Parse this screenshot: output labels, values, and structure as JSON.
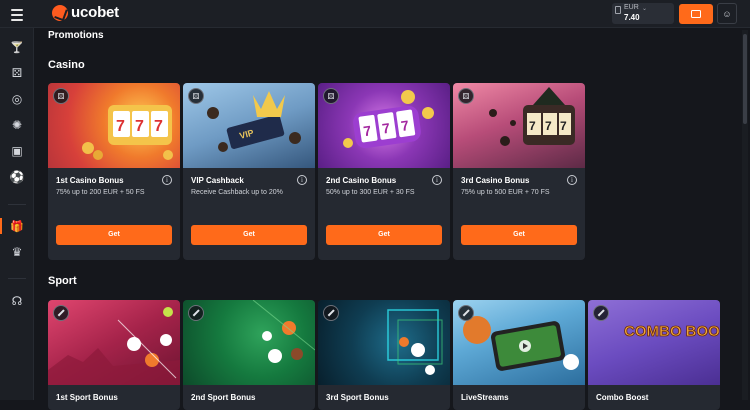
{
  "brand": {
    "name": "ucobet",
    "accent": "#ff6a1a"
  },
  "header": {
    "currency": "EUR",
    "balance": "7.40",
    "deposit_icon": "wallet-icon",
    "profile_icon": "user-icon"
  },
  "sidebar": {
    "items": [
      {
        "icon": "cocktail-icon",
        "glyph": "🍸"
      },
      {
        "icon": "dice-icon",
        "glyph": "⚄"
      },
      {
        "icon": "sport-ball-icon",
        "glyph": "◎"
      },
      {
        "icon": "roulette-icon",
        "glyph": "✺"
      },
      {
        "icon": "live-icon",
        "glyph": "▣"
      },
      {
        "icon": "football-icon",
        "glyph": "⚽"
      },
      {
        "icon": "gift-icon",
        "glyph": "🎁"
      },
      {
        "icon": "crown-icon",
        "glyph": "♛"
      },
      {
        "icon": "support-icon",
        "glyph": "☊"
      }
    ]
  },
  "main": {
    "title": "Promotions",
    "casino": {
      "title": "Casino",
      "cards": [
        {
          "title": "1st Casino Bonus",
          "desc": "75% up to 200 EUR + 50 FS",
          "button": "Get"
        },
        {
          "title": "VIP Cashback",
          "desc": "Receive Cashback up to 20%",
          "button": "Get"
        },
        {
          "title": "2nd Casino Bonus",
          "desc": "50% up to 300 EUR + 30 FS",
          "button": "Get"
        },
        {
          "title": "3rd Casino Bonus",
          "desc": "75% up to 500 EUR + 70 FS",
          "button": "Get"
        }
      ]
    },
    "sport": {
      "title": "Sport",
      "cards": [
        {
          "title": "1st Sport Bonus"
        },
        {
          "title": "2nd Sport Bonus"
        },
        {
          "title": "3rd Sport Bonus"
        },
        {
          "title": "LiveStreams"
        },
        {
          "title": "Combo Boost",
          "art_text": "COMBO BOOST"
        }
      ]
    }
  }
}
